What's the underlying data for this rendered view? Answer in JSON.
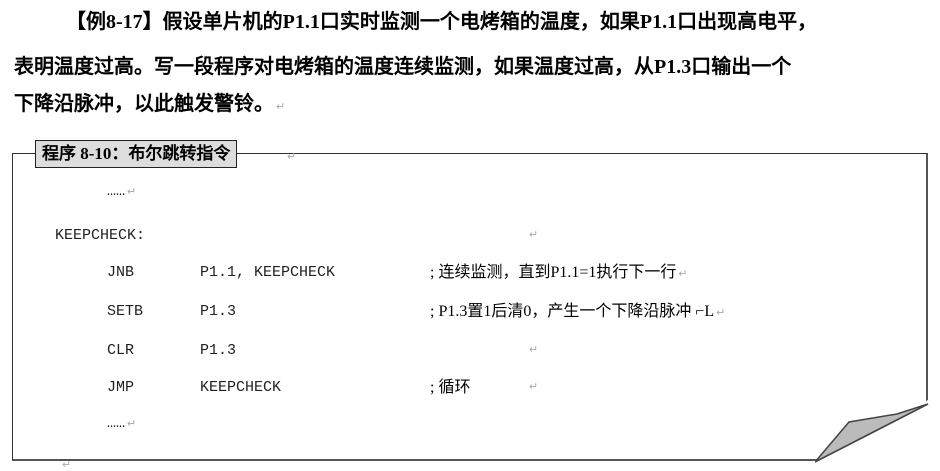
{
  "problem": {
    "lines": [
      "【例8-17】假设单片机的P1.1口实时监测一个电烤箱的温度，如果P1.1口出现高电平，",
      "表明温度过高。写一段程序对电烤箱的温度连续监测，如果温度过高，从P1.3口输出一个",
      "下降沿脉冲，以此触发警铃。"
    ]
  },
  "program": {
    "title": "程序 8-10：布尔跳转指令",
    "ellipsis": "……",
    "label": "KEEPCHECK:",
    "rows": [
      {
        "op": "JNB",
        "arg": "P1.1, KEEPCHECK",
        "comment": "; 连续监测，直到P1.1=1执行下一行"
      },
      {
        "op": "SETB",
        "arg": "P1.3",
        "comment": "; P1.3置1后清0，产生一个下降沿脉冲 ⌐L"
      },
      {
        "op": "CLR",
        "arg": "P1.3",
        "comment": ""
      },
      {
        "op": "JMP",
        "arg": "KEEPCHECK",
        "comment": "; 循环"
      }
    ]
  },
  "paragraph_mark": "↵"
}
